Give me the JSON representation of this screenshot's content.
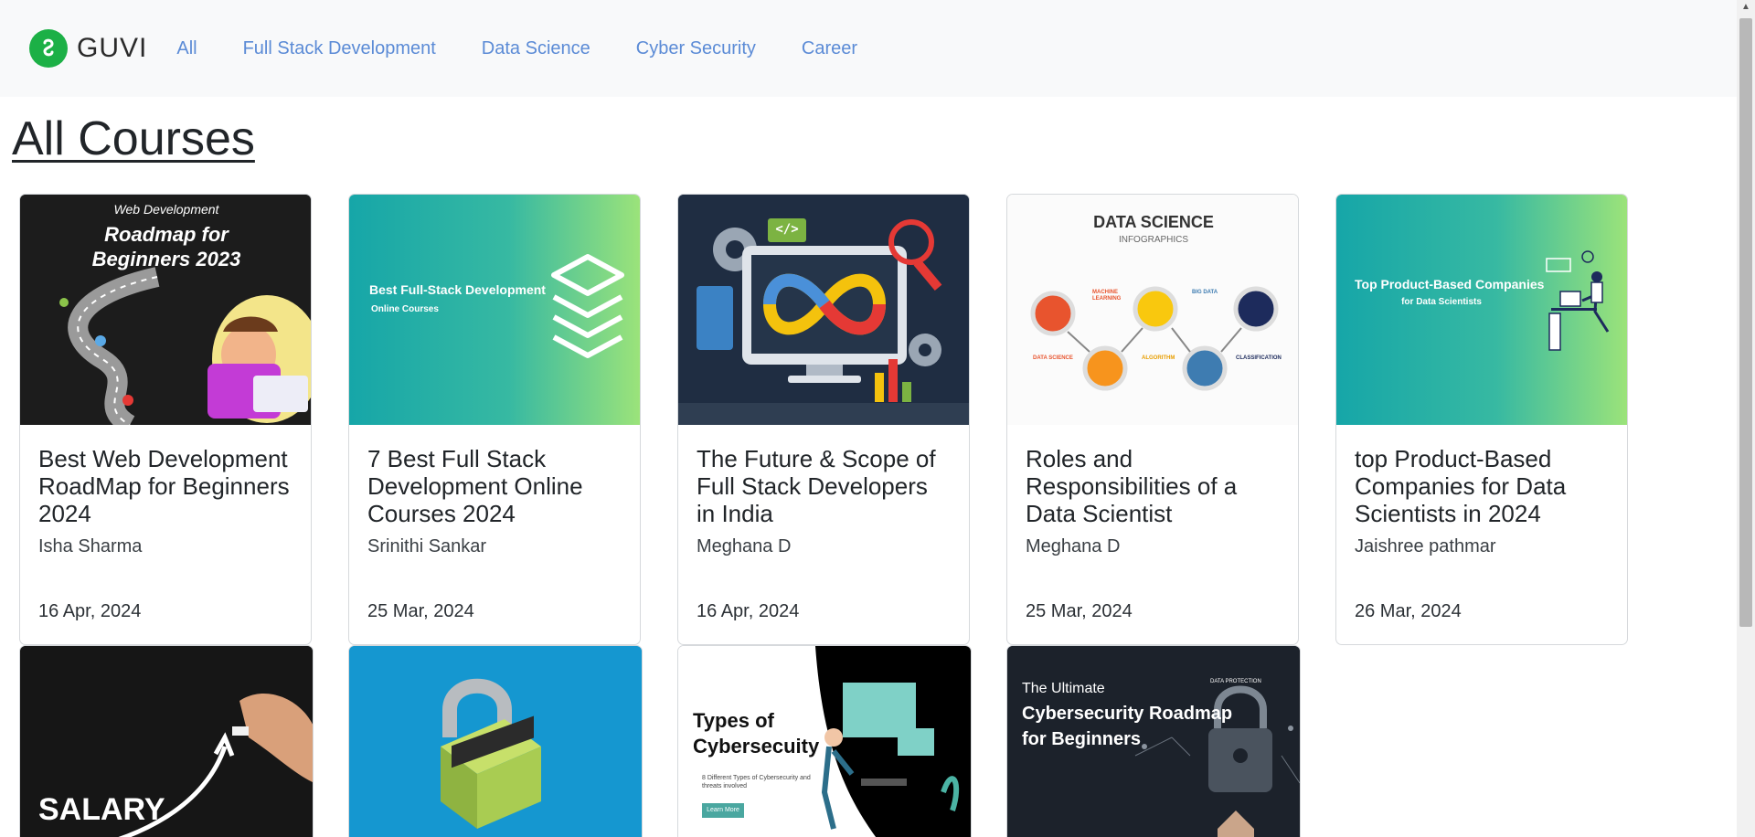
{
  "brand": {
    "name": "GUVI",
    "icon": "guvi-logo-icon",
    "color": "#1cb046"
  },
  "nav": {
    "items": [
      {
        "label": "All"
      },
      {
        "label": "Full Stack Development"
      },
      {
        "label": "Data Science"
      },
      {
        "label": "Cyber Security"
      },
      {
        "label": "Career"
      }
    ],
    "link_color": "#5b8bd6"
  },
  "page": {
    "title": "All Courses"
  },
  "cards": [
    {
      "title": "Best Web Development RoadMap for Beginners 2024",
      "author": "Isha Sharma",
      "date": "16 Apr, 2024",
      "thumb": {
        "kicker": "Web Development",
        "headline1": "Roadmap for",
        "headline2": "Beginners 2023"
      }
    },
    {
      "title": "7 Best Full Stack Development Online Courses 2024",
      "author": "Srinithi Sankar",
      "date": "25 Mar, 2024",
      "thumb": {
        "headline1": "Best Full-Stack Development",
        "headline2": "Online Courses"
      }
    },
    {
      "title": "The Future & Scope of Full Stack Developers in India",
      "author": "Meghana D",
      "date": "16 Apr, 2024",
      "thumb": {
        "code_tag": "</>"
      }
    },
    {
      "title": "Roles and Responsibilities of a Data Scientist",
      "author": "Meghana D",
      "date": "25 Mar, 2024",
      "thumb": {
        "headline1": "DATA SCIENCE",
        "headline2": "INFOGRAPHICS",
        "labels": [
          "DATA SCIENCE",
          "MACHINE LEARNING",
          "ALGORITHM",
          "BIG DATA",
          "CLASSIFICATION"
        ]
      }
    },
    {
      "title": "top Product-Based Companies for Data Scientists in 2024",
      "author": "Jaishree pathmar",
      "date": "26 Mar, 2024",
      "thumb": {
        "headline1": "Top Product-Based Companies",
        "headline2": "for Data Scientists"
      }
    }
  ],
  "cards_row2": [
    {
      "thumb": {
        "headline1": "SALARY"
      }
    },
    {
      "thumb": {}
    },
    {
      "thumb": {
        "headline1": "Types of",
        "headline2": "Cybersecuity",
        "sub": "8 Different Types of Cybersecurity and threats involved",
        "button": "Learn More"
      }
    },
    {
      "thumb": {
        "headline0": "The Ultimate",
        "headline1": "Cybersecurity Roadmap",
        "headline2": "for Beginners",
        "tag": "DATA PROTECTION"
      }
    }
  ]
}
